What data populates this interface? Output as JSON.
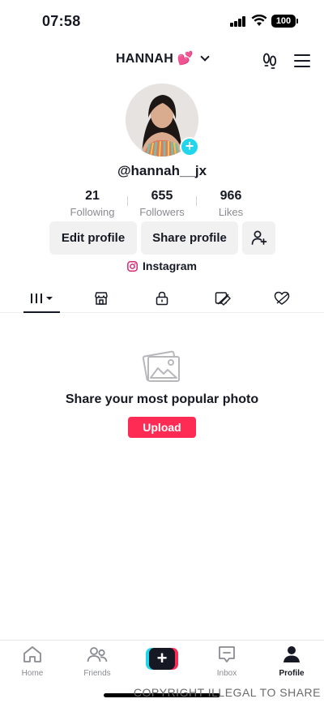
{
  "status_bar": {
    "time": "07:58",
    "battery": "100"
  },
  "header": {
    "name": "HANNAH 💕",
    "icons": [
      "footprint-icon",
      "menu-icon"
    ]
  },
  "profile": {
    "username": "@hannah__jx",
    "stats": [
      {
        "value": "21",
        "label": "Following"
      },
      {
        "value": "655",
        "label": "Followers"
      },
      {
        "value": "966",
        "label": "Likes"
      }
    ],
    "edit_profile_label": "Edit profile",
    "share_profile_label": "Share profile",
    "instagram_label": "Instagram"
  },
  "tabs": [
    "grid-icon",
    "shop-icon",
    "lock-icon",
    "repost-icon",
    "liked-icon"
  ],
  "empty_state": {
    "title": "Share your most popular photo",
    "upload_label": "Upload"
  },
  "bottom_nav": {
    "items": [
      {
        "label": "Home"
      },
      {
        "label": "Friends"
      },
      {
        "label": "Inbox"
      },
      {
        "label": "Profile"
      }
    ]
  },
  "watermark": "COPYRIGHT ILLEGAL TO SHARE",
  "colors": {
    "accent_red": "#fe2c55",
    "accent_cyan": "#20d5ec",
    "text": "#161823",
    "muted": "#8a8b91"
  }
}
